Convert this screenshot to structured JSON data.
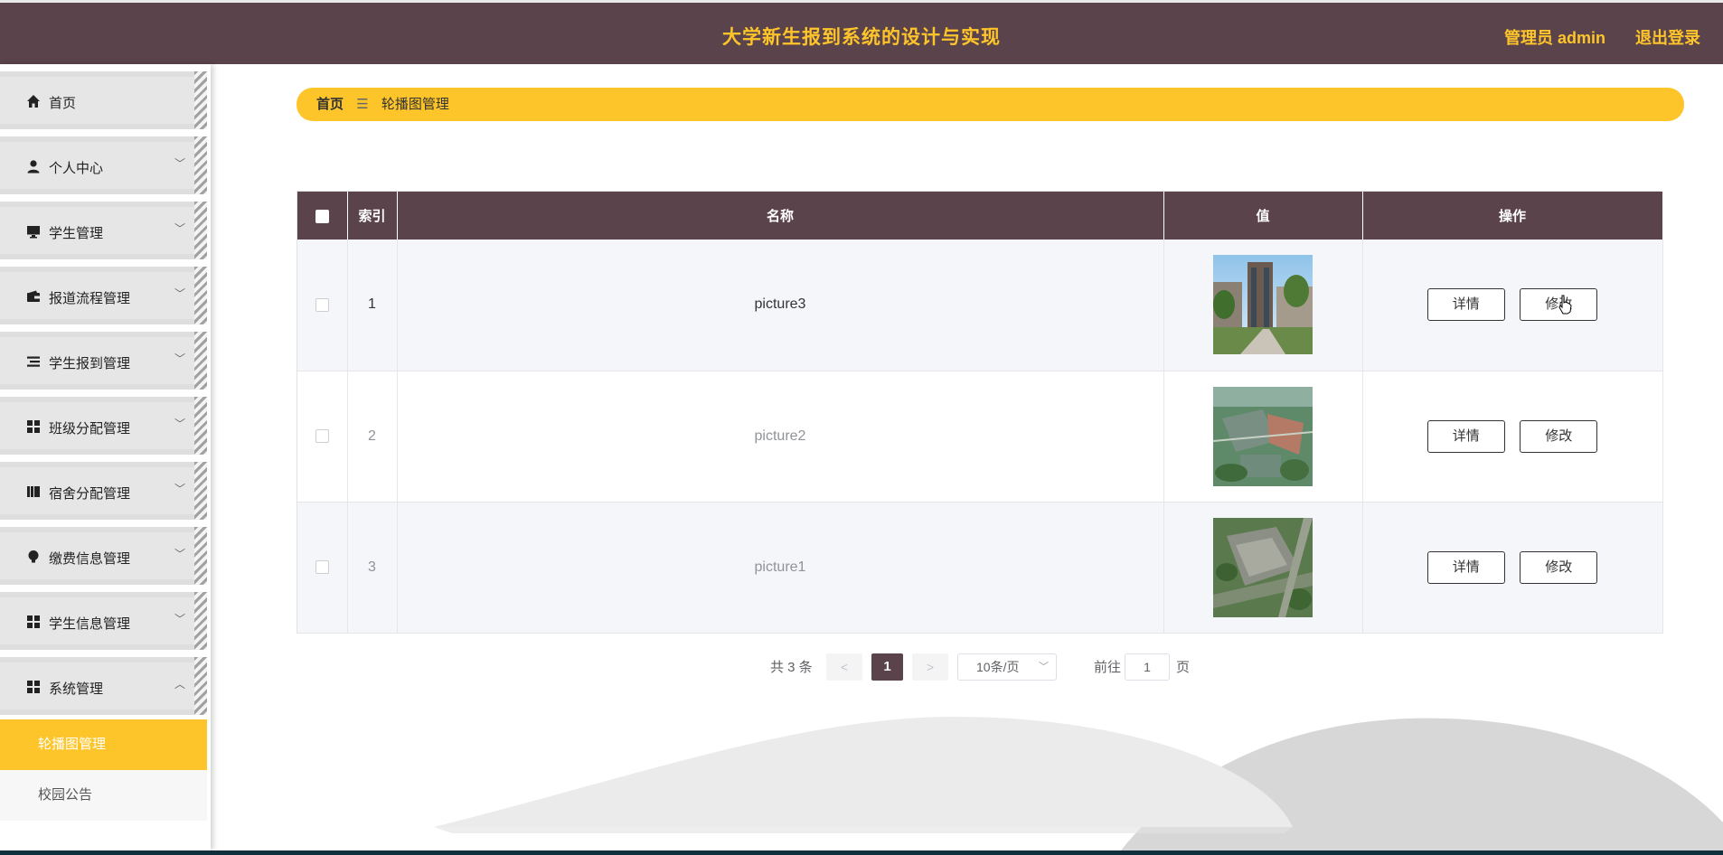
{
  "header": {
    "title": "大学新生报到系统的设计与实现",
    "user_label": "管理员 admin",
    "logout_label": "退出登录"
  },
  "sidebar": {
    "items": [
      {
        "label": "首页",
        "icon": "home-icon",
        "has_chevron": false
      },
      {
        "label": "个人中心",
        "icon": "person-icon",
        "has_chevron": true
      },
      {
        "label": "学生管理",
        "icon": "monitor-icon",
        "has_chevron": true
      },
      {
        "label": "报道流程管理",
        "icon": "wallet-icon",
        "has_chevron": true
      },
      {
        "label": "学生报到管理",
        "icon": "list-icon",
        "has_chevron": true
      },
      {
        "label": "班级分配管理",
        "icon": "grid-icon",
        "has_chevron": true
      },
      {
        "label": "宿舍分配管理",
        "icon": "book-icon",
        "has_chevron": true
      },
      {
        "label": "缴费信息管理",
        "icon": "bulb-icon",
        "has_chevron": true
      },
      {
        "label": "学生信息管理",
        "icon": "grid-icon",
        "has_chevron": true
      },
      {
        "label": "系统管理",
        "icon": "grid-icon",
        "has_chevron": true,
        "expanded": true
      }
    ],
    "sub_items": [
      {
        "label": "轮播图管理",
        "active": true
      },
      {
        "label": "校园公告",
        "active": false
      }
    ]
  },
  "breadcrumb": {
    "home": "首页",
    "separator_icon": "menu-icon",
    "current": "轮播图管理"
  },
  "table": {
    "columns": [
      "索引",
      "名称",
      "值",
      "操作"
    ],
    "rows": [
      {
        "index": "1",
        "name": "picture3",
        "image": "building-photo",
        "details": "详情",
        "edit": "修改"
      },
      {
        "index": "2",
        "name": "picture2",
        "image": "campus-aerial-photo",
        "details": "详情",
        "edit": "修改"
      },
      {
        "index": "3",
        "name": "picture1",
        "image": "campus-aerial-photo",
        "details": "详情",
        "edit": "修改"
      }
    ]
  },
  "pagination": {
    "total_text": "共 3 条",
    "prev": "<",
    "current_page": "1",
    "next": ">",
    "page_size": "10条/页",
    "goto_label": "前往",
    "goto_value": "1",
    "page_unit": "页"
  },
  "colors": {
    "primary": "#5b434c",
    "accent": "#fec52a"
  }
}
